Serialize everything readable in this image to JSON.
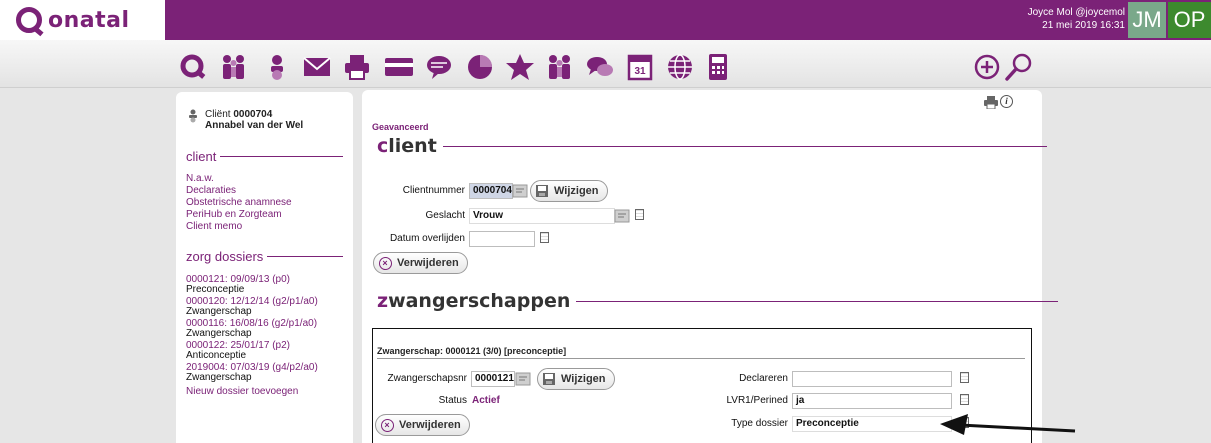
{
  "app": {
    "brand": "onatal"
  },
  "user": {
    "name": "Joyce Mol @joycemol",
    "datetime": "21 mei 2019 16:31",
    "initials": "JM",
    "badge": "OP"
  },
  "toolbar": {
    "icons": [
      "home-q-icon",
      "people-icon",
      "person-icon",
      "mail-icon",
      "print-icon",
      "card-icon",
      "speech-bubble-icon",
      "pie-chart-icon",
      "star-icon",
      "group-icon",
      "chat-icon",
      "calendar-icon",
      "globe-icon",
      "calculator-icon"
    ],
    "calendar_day": "31",
    "right_icons": [
      "add-icon",
      "search-icon"
    ]
  },
  "sidebar": {
    "client_label": "Cliënt",
    "client_number": "0000704",
    "client_name": "Annabel van der Wel",
    "client_section": "client",
    "client_links": [
      "N.a.w.",
      "Declaraties",
      "Obstetrische anamnese",
      "PeriHub en Zorgteam",
      "Client memo"
    ],
    "zorg_section": "zorg dossiers",
    "dossiers": [
      {
        "id": "0000121: 09/09/13 (p0)",
        "type": "Preconceptie"
      },
      {
        "id": "0000120: 12/12/14 (g2/p1/a0)",
        "type": "Zwangerschap"
      },
      {
        "id": "0000116: 16/08/16 (g2/p1/a0)",
        "type": "Zwangerschap"
      },
      {
        "id": "0000122: 25/01/17 (p2)",
        "type": "Anticonceptie"
      },
      {
        "id": "2019004: 07/03/19 (g4/p2/a0)",
        "type": "Zwangerschap"
      }
    ],
    "new_dossier": "Nieuw dossier toevoegen"
  },
  "main": {
    "breadcrumb": "Geavanceerd",
    "client_heading_first": "c",
    "client_heading_rest": "lient",
    "clientnummer_label": "Clientnummer",
    "clientnummer_value": "0000704",
    "wijzigen_label": "Wijzigen",
    "geslacht_label": "Geslacht",
    "geslacht_value": "Vrouw",
    "datum_label": "Datum overlijden",
    "datum_value": "",
    "verwijderen_label": "Verwijderen",
    "zw_heading_first": "z",
    "zw_heading_rest": "wangerschappen",
    "zw_title": "Zwangerschap: 0000121 (3/0) [preconceptie]",
    "zwangerschapsnr_label": "Zwangerschapsnr",
    "zwangerschapsnr_value": "0000121",
    "status_label": "Status",
    "status_value": "Actief",
    "declareren_label": "Declareren",
    "declareren_value": "",
    "lvr_label": "LVR1/Perined",
    "lvr_value": "ja",
    "type_label": "Type dossier",
    "type_value": "Preconceptie"
  },
  "colors": {
    "brand": "#7b2277",
    "op_badge": "#3d8a2e",
    "jm_badge": "#7aa88a"
  }
}
